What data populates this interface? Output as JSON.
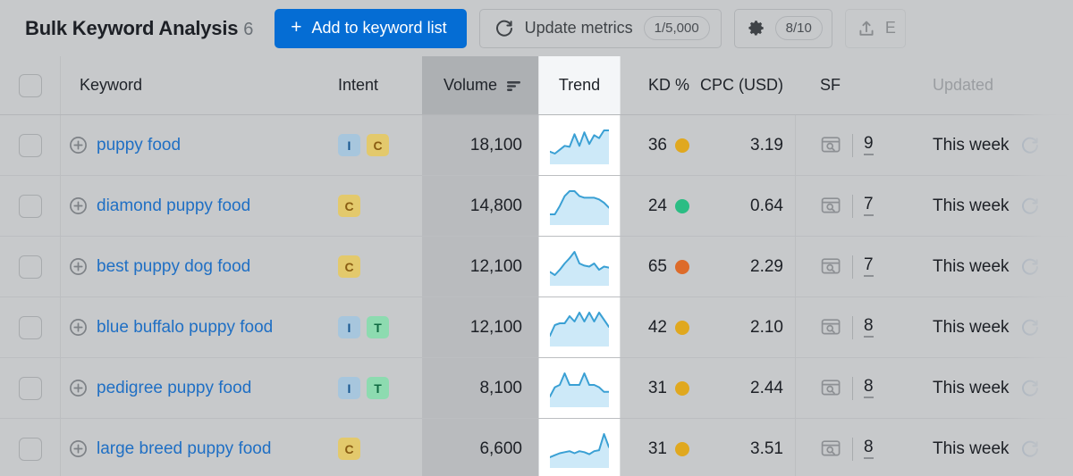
{
  "header": {
    "title": "Bulk Keyword Analysis",
    "count": "6",
    "add_to_list_label": "Add to keyword list",
    "add_icon": "plus-icon",
    "update_metrics_label": "Update metrics",
    "update_metrics_icon": "refresh-icon",
    "update_metrics_quota": "1/5,000",
    "settings_icon": "gear-icon",
    "settings_quota": "8/10",
    "export_label": "E",
    "export_icon": "upload-icon",
    "primary_color": "#056dd4"
  },
  "table": {
    "columns": [
      {
        "key": "check",
        "label": "",
        "sorted": false
      },
      {
        "key": "keyword",
        "label": "Keyword",
        "sorted": false
      },
      {
        "key": "intent",
        "label": "Intent",
        "sorted": false
      },
      {
        "key": "volume",
        "label": "Volume",
        "sorted": true,
        "sort_icon": "sort-descending-icon"
      },
      {
        "key": "trend",
        "label": "Trend",
        "sorted": false
      },
      {
        "key": "kd",
        "label": "KD %",
        "sorted": false
      },
      {
        "key": "cpc",
        "label": "CPC (USD)",
        "sorted": false
      },
      {
        "key": "sf",
        "label": "SF",
        "sorted": false
      },
      {
        "key": "updated",
        "label": "Updated",
        "sorted": false,
        "muted": true
      }
    ],
    "rows": [
      {
        "keyword": "puppy food",
        "intent": [
          "I",
          "C"
        ],
        "volume": "18,100",
        "kd": "36",
        "kd_color": "#e0a81f",
        "cpc": "3.19",
        "sf_value": "9",
        "sf_icon": "serp-features-icon",
        "updated": "This week",
        "updated_icon": "refresh-icon",
        "trend": [
          38,
          36,
          40,
          44,
          43,
          56,
          44,
          58,
          46,
          55,
          52,
          60,
          60
        ]
      },
      {
        "keyword": "diamond puppy food",
        "intent": [
          "C"
        ],
        "volume": "14,800",
        "kd": "24",
        "kd_color": "#2bbd84",
        "cpc": "0.64",
        "sf_value": "7",
        "sf_icon": "serp-features-icon",
        "updated": "This week",
        "updated_icon": "refresh-icon",
        "trend": [
          34,
          34,
          44,
          56,
          62,
          62,
          56,
          54,
          54,
          54,
          52,
          48,
          42
        ]
      },
      {
        "keyword": "best puppy dog food",
        "intent": [
          "C"
        ],
        "volume": "12,100",
        "kd": "65",
        "kd_color": "#dd6b2a",
        "cpc": "2.29",
        "sf_value": "7",
        "sf_icon": "serp-features-icon",
        "updated": "This week",
        "updated_icon": "refresh-icon",
        "trend": [
          36,
          30,
          40,
          52,
          62,
          74,
          52,
          48,
          46,
          52,
          40,
          46,
          44
        ]
      },
      {
        "keyword": "blue buffalo puppy food",
        "intent": [
          "I",
          "T"
        ],
        "volume": "12,100",
        "kd": "42",
        "kd_color": "#e0a81f",
        "cpc": "2.10",
        "sf_value": "8",
        "sf_icon": "serp-features-icon",
        "updated": "This week",
        "updated_icon": "refresh-icon",
        "trend": [
          36,
          48,
          50,
          50,
          58,
          52,
          62,
          52,
          62,
          52,
          62,
          54,
          46
        ]
      },
      {
        "keyword": "pedigree puppy food",
        "intent": [
          "I",
          "T"
        ],
        "volume": "8,100",
        "kd": "31",
        "kd_color": "#e0a81f",
        "cpc": "2.44",
        "sf_value": "8",
        "sf_icon": "serp-features-icon",
        "updated": "This week",
        "updated_icon": "refresh-icon",
        "trend": [
          42,
          50,
          52,
          62,
          52,
          52,
          52,
          62,
          52,
          52,
          50,
          46,
          46
        ]
      },
      {
        "keyword": "large breed puppy food",
        "intent": [
          "C"
        ],
        "volume": "6,600",
        "kd": "31",
        "kd_color": "#e0a81f",
        "cpc": "3.51",
        "sf_value": "8",
        "sf_icon": "serp-features-icon",
        "updated": "This week",
        "updated_icon": "refresh-icon",
        "trend": [
          32,
          36,
          40,
          42,
          44,
          40,
          44,
          42,
          38,
          44,
          46,
          78,
          52
        ]
      }
    ],
    "intent_colors": {
      "I": "#a7c6dd",
      "C": "#e3c96c",
      "T": "#8ddbb0",
      "N": "#c3b3e0"
    },
    "trend_line_color": "#3aa0d4",
    "trend_fill_color": "#cde9f8"
  }
}
